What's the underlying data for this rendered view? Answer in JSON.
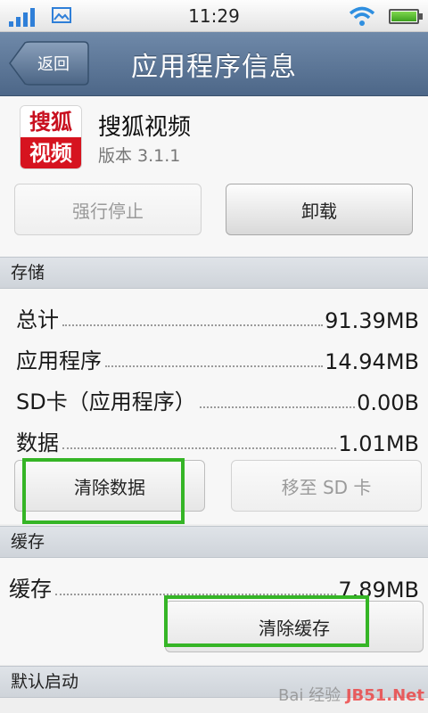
{
  "status_bar": {
    "time": "11:29"
  },
  "title_bar": {
    "back_label": "返回",
    "title": "应用程序信息"
  },
  "app": {
    "icon_text_top": "搜狐",
    "icon_text_bottom": "视频",
    "name": "搜狐视频",
    "version": "版本 3.1.1",
    "force_stop_label": "强行停止",
    "uninstall_label": "卸载"
  },
  "storage": {
    "header": "存储",
    "rows": [
      {
        "label": "总计",
        "value": "91.39MB"
      },
      {
        "label": "应用程序",
        "value": "14.94MB"
      },
      {
        "label": "SD卡（应用程序）",
        "value": "0.00B"
      },
      {
        "label": "数据",
        "value": "1.01MB"
      }
    ],
    "clear_data_label": "清除数据",
    "move_to_sd_label": "移至 SD 卡"
  },
  "cache": {
    "header": "缓存",
    "row": {
      "label": "缓存",
      "value": "7.89MB"
    },
    "clear_cache_label": "清除缓存"
  },
  "default_launch": {
    "header": "默认启动"
  },
  "watermark": {
    "text": "Bai 经验",
    "site": "JB51.Net"
  },
  "colors": {
    "highlight": "#35b526",
    "titlebar": "#5c7696"
  }
}
